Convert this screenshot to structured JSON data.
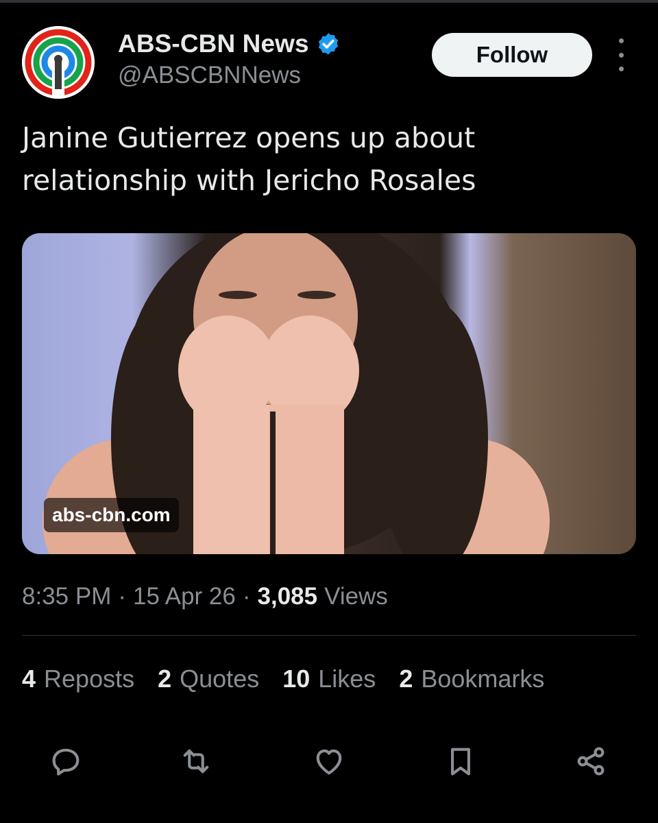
{
  "post": {
    "author": {
      "display_name": "ABS-CBN News",
      "handle": "@ABSCBNNews",
      "verified": true,
      "avatar_icon": "abs-cbn-logo"
    },
    "follow_label": "Follow",
    "text": "Janine Gutierrez opens up about relationship with Jericho Rosales",
    "media": {
      "type": "link-card-photo",
      "domain_label": "abs-cbn.com"
    },
    "meta": {
      "time": "8:35 PM",
      "separator": "·",
      "date": "15 Apr 26",
      "views_count": "3,085",
      "views_label": "Views"
    },
    "stats": [
      {
        "count": "4",
        "label": "Reposts"
      },
      {
        "count": "2",
        "label": "Quotes"
      },
      {
        "count": "10",
        "label": "Likes"
      },
      {
        "count": "2",
        "label": "Bookmarks"
      }
    ],
    "actions": [
      "reply-icon",
      "repost-icon",
      "like-icon",
      "bookmark-icon",
      "share-icon"
    ]
  },
  "colors": {
    "background": "#000000",
    "text_primary": "#e7e9ea",
    "text_secondary": "#8b8f94",
    "verified_blue": "#1d9bf0",
    "follow_bg": "#eff3f4",
    "divider": "#2f3336"
  }
}
